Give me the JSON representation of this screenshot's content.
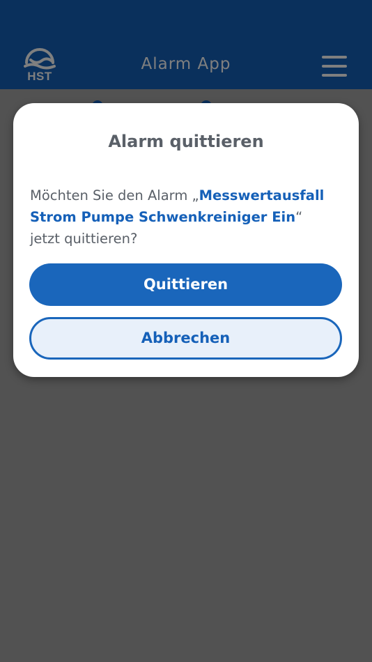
{
  "header": {
    "logo_text": "HST",
    "title": "Alarm App",
    "menu_icon": "hamburger-menu-icon"
  },
  "dialog": {
    "title": "Alarm quittieren",
    "message_prefix": "Möchten Sie den Alarm „",
    "alarm_name": "Messwertausfall Strom Pumpe Schwenkreiniger Ein",
    "message_suffix": "“ jetzt quittieren?",
    "confirm_label": "Quittieren",
    "cancel_label": "Abbrechen"
  },
  "colors": {
    "primary": "#1560b8",
    "text": "#5a6068",
    "secondary_bg": "#e8f0fa",
    "overlay": "rgba(0,0,0,0.5)"
  }
}
